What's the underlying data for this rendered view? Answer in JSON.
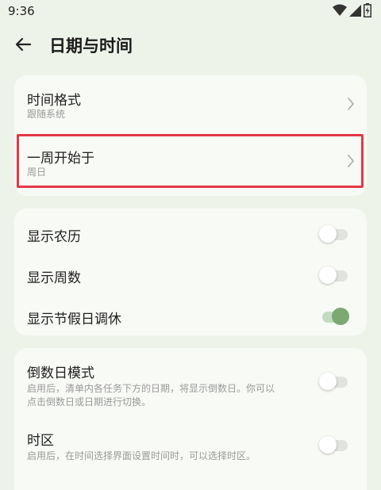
{
  "status_bar": {
    "time": "9:36"
  },
  "header": {
    "title": "日期与时间"
  },
  "card1": {
    "items": [
      {
        "title": "时间格式",
        "subtitle": "跟随系统"
      },
      {
        "title": "一周开始于",
        "subtitle": "周日"
      }
    ]
  },
  "card2": {
    "items": [
      {
        "title": "显示农历",
        "on": false
      },
      {
        "title": "显示周数",
        "on": false
      },
      {
        "title": "显示节假日调休",
        "on": true
      }
    ]
  },
  "card3": {
    "items": [
      {
        "title": "倒数日模式",
        "desc_line1": "启用后，清单内各任务下方的日期，将显示倒数日。你可以",
        "desc_line2": "点击倒数日或日期进行切换。",
        "on": false
      },
      {
        "title": "时区",
        "desc_line1": "启用后，在时间选择界面设置时间时，可以选择时区。",
        "on": false
      }
    ]
  },
  "colors": {
    "background": "#eef3ea",
    "card": "#f8faf6",
    "accent": "#7ca872",
    "highlight": "#e53945"
  },
  "icons": [
    "wifi-icon",
    "signal-icon",
    "battery-icon",
    "back-arrow-icon",
    "chevron-right-icon"
  ]
}
